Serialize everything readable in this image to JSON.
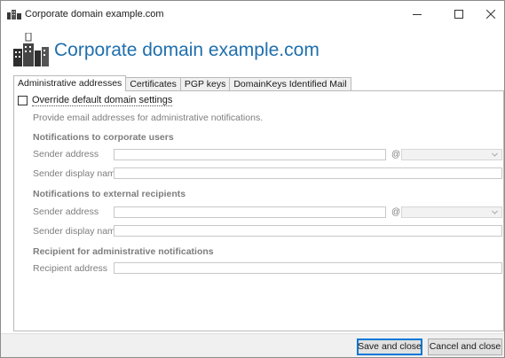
{
  "window": {
    "title": "Corporate domain example.com",
    "controls": {
      "minimize": "–",
      "maximize": "☐",
      "close": "✕"
    }
  },
  "header": {
    "title": "Corporate domain example.com",
    "icon": "domain-building-icon",
    "accent_color": "#1f6fad"
  },
  "tabs": [
    {
      "label": "Administrative addresses",
      "active": true
    },
    {
      "label": "Certificates",
      "active": false
    },
    {
      "label": "PGP keys",
      "active": false
    },
    {
      "label": "DomainKeys Identified Mail",
      "active": false
    }
  ],
  "panel": {
    "override_label": "Override default domain settings",
    "override_checked": false,
    "description": "Provide email addresses for administrative notifications.",
    "corporate": {
      "heading": "Notifications to corporate users",
      "sender_address_label": "Sender address",
      "sender_address_value": "",
      "at_symbol": "@",
      "domain_value": "",
      "sender_display_name_label": "Sender display name",
      "sender_display_name_value": ""
    },
    "external": {
      "heading": "Notifications to external recipients",
      "sender_address_label": "Sender address",
      "sender_address_value": "",
      "at_symbol": "@",
      "domain_value": "",
      "sender_display_name_label": "Sender display name",
      "sender_display_name_value": ""
    },
    "admin": {
      "heading": "Recipient for administrative notifications",
      "recipient_address_label": "Recipient address",
      "recipient_address_value": ""
    }
  },
  "footer": {
    "save_label": "Save and close",
    "cancel_label": "Cancel and close"
  }
}
